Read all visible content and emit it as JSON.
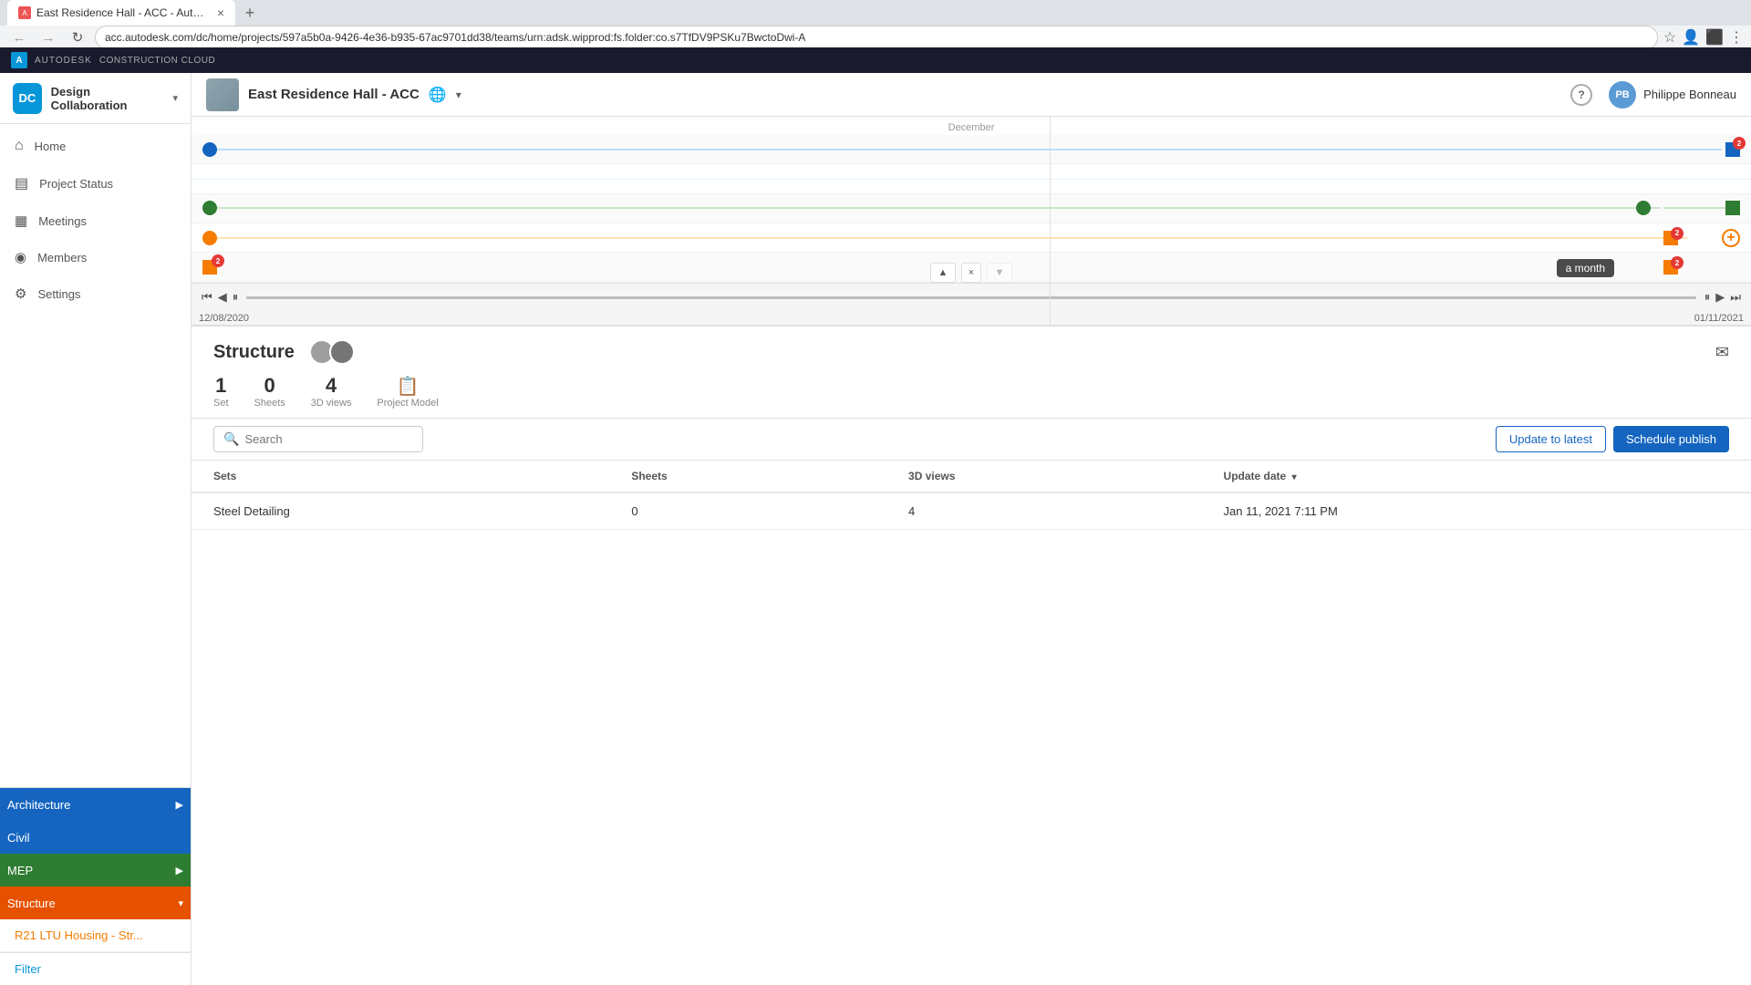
{
  "browser": {
    "tab_title": "East Residence Hall - ACC - Auto...",
    "tab_close": "×",
    "new_tab": "+",
    "url": "acc.autodesk.com/dc/home/projects/597a5b0a-9426-4e36-b935-67ac9701dd38/teams/urn:adsk.wipprod:fs.folder:co.s7TfDV9PSKu7BwctoDwi-A",
    "nav_buttons": [
      "←",
      "→",
      "↻"
    ]
  },
  "autodesk_bar": {
    "logo": "A",
    "company": "AUTODESK",
    "product": "CONSTRUCTION CLOUD"
  },
  "sidebar": {
    "title": "Design Collaboration",
    "logo_text": "DC",
    "nav_items": [
      {
        "id": "home",
        "label": "Home",
        "icon": "home",
        "active": false
      },
      {
        "id": "project-status",
        "label": "Project Status",
        "icon": "chart",
        "active": false
      },
      {
        "id": "meetings",
        "label": "Meetings",
        "icon": "calendar",
        "active": false
      },
      {
        "id": "members",
        "label": "Members",
        "icon": "members",
        "active": false
      },
      {
        "id": "settings",
        "label": "Settings",
        "icon": "settings",
        "active": false
      }
    ],
    "filter_label": "Filter"
  },
  "project_header": {
    "name": "East Residence Hall - ACC",
    "help": "?",
    "user_name": "Philippe Bonneau",
    "user_initials": "PB"
  },
  "gantt": {
    "rows": [
      {
        "id": "arch",
        "label": "Architecture",
        "color": "#1565c0",
        "expandable": true
      },
      {
        "id": "civil",
        "label": "Civil",
        "color": "#1565c0",
        "expandable": false
      },
      {
        "id": "mep",
        "label": "MEP",
        "color": "#2e7d32",
        "expandable": true
      },
      {
        "id": "struct",
        "label": "Structure",
        "color": "#e65100",
        "expandable": true
      },
      {
        "id": "substruct",
        "label": "R21 LTU Housing - Str...",
        "color": "transparent",
        "expandable": false,
        "is_sub": true
      }
    ],
    "date_start": "12/08/2020",
    "date_end": "01/11/2021",
    "month_label": "December",
    "tooltip": "a month"
  },
  "structure": {
    "title": "Structure",
    "stats": {
      "sets": {
        "value": "1",
        "label": "Set"
      },
      "sheets": {
        "value": "0",
        "label": "Sheets"
      },
      "views_3d": {
        "value": "4",
        "label": "3D views"
      },
      "project_model": {
        "label": "Project Model",
        "icon": "📋"
      }
    },
    "search_placeholder": "Search",
    "buttons": {
      "update": "Update to latest",
      "schedule": "Schedule publish"
    },
    "table": {
      "columns": [
        {
          "id": "sets",
          "label": "Sets",
          "sortable": false
        },
        {
          "id": "sheets",
          "label": "Sheets",
          "sortable": false
        },
        {
          "id": "views_3d",
          "label": "3D views",
          "sortable": false
        },
        {
          "id": "update_date",
          "label": "Update date",
          "sortable": true
        }
      ],
      "rows": [
        {
          "sets": "Steel Detailing",
          "sheets": "0",
          "views_3d": "4",
          "update_date": "Jan 11, 2021 7:11 PM"
        }
      ]
    }
  }
}
